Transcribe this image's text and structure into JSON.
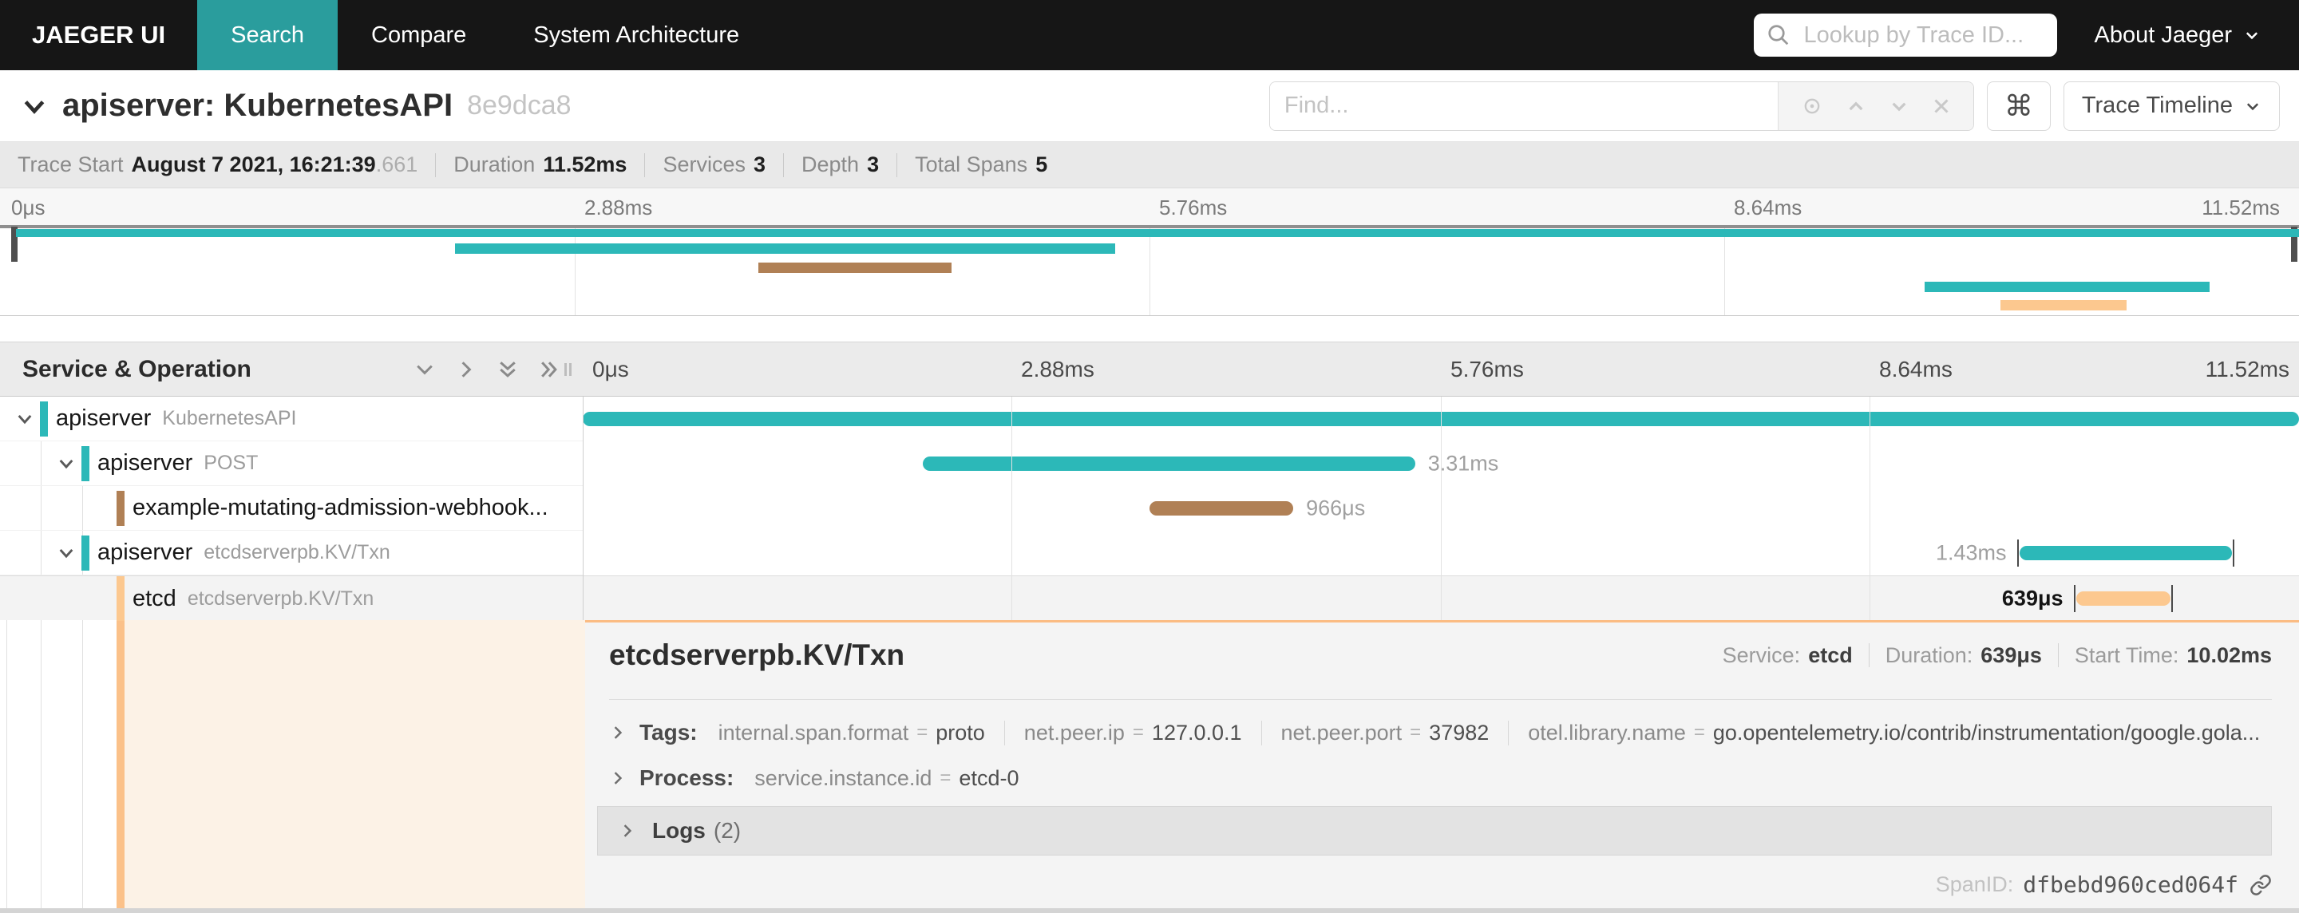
{
  "nav": {
    "brand": "JAEGER UI",
    "tabs": [
      {
        "label": "Search"
      },
      {
        "label": "Compare"
      },
      {
        "label": "System Architecture"
      }
    ],
    "lookup_placeholder": "Lookup by Trace ID...",
    "about_label": "About Jaeger",
    "active_tab_color": "#2a9d9d"
  },
  "trace_header": {
    "title": "apiserver: KubernetesAPI",
    "trace_id": "8e9dca8",
    "find_placeholder": "Find...",
    "shortcut_symbol": "⌘",
    "view_label": "Trace Timeline"
  },
  "summary": {
    "trace_start_label": "Trace Start",
    "trace_start_value": "August 7 2021, 16:21:39",
    "trace_start_fraction": ".661",
    "duration_label": "Duration",
    "duration_value": "11.52ms",
    "services_label": "Services",
    "services_value": "3",
    "depth_label": "Depth",
    "depth_value": "3",
    "spans_label": "Total Spans",
    "spans_value": "5"
  },
  "minimap": {
    "ticks": [
      "0μs",
      "2.88ms",
      "5.76ms",
      "8.64ms",
      "11.52ms"
    ],
    "spans": [
      {
        "left": "0.7%",
        "width": "99.3%",
        "color": "#2cb8b8"
      },
      {
        "left": "19.8%",
        "width": "28.7%",
        "color": "#2cb8b8"
      },
      {
        "left": "33.0%",
        "width": "8.4%",
        "color": "#b08055"
      },
      {
        "left": "83.7%",
        "width": "12.4%",
        "color": "#2cb8b8"
      },
      {
        "left": "87.0%",
        "width": "5.5%",
        "color": "#fcc88f"
      }
    ]
  },
  "timeline": {
    "panel_title": "Service & Operation",
    "ticks": [
      "0μs",
      "2.88ms",
      "5.76ms",
      "8.64ms",
      "11.52ms"
    ],
    "rows": [
      {
        "name": "apiserver",
        "op": "KubernetesAPI",
        "bar": {
          "left": "0%",
          "width": "100%",
          "color": "#2cb8b8"
        },
        "duration_label": ""
      },
      {
        "name": "apiserver",
        "op": "POST",
        "bar": {
          "left": "19.8%",
          "width": "28.7%",
          "color": "#2cb8b8"
        },
        "duration_label": "3.31ms"
      },
      {
        "name": "example-mutating-admission-webhook...",
        "op": "",
        "bar": {
          "left": "33.0%",
          "width": "8.4%",
          "color": "#b08055"
        },
        "duration_label": "966μs"
      },
      {
        "name": "apiserver",
        "op": "etcdserverpb.KV/Txn",
        "bar": {
          "left": "83.7%",
          "width": "12.4%",
          "color": "#2cb8b8"
        },
        "duration_label": "1.43ms"
      },
      {
        "name": "etcd",
        "op": "etcdserverpb.KV/Txn",
        "bar": {
          "left": "87.0%",
          "width": "5.5%",
          "color": "#fcc88f"
        },
        "duration_label": "639μs"
      }
    ]
  },
  "detail": {
    "title": "etcdserverpb.KV/Txn",
    "service_label": "Service:",
    "service_value": "etcd",
    "duration_label": "Duration:",
    "duration_value": "639μs",
    "start_label": "Start Time:",
    "start_value": "10.02ms",
    "eq": "=",
    "tags_label": "Tags:",
    "tags": [
      {
        "key": "internal.span.format",
        "value": "proto"
      },
      {
        "key": "net.peer.ip",
        "value": "127.0.0.1"
      },
      {
        "key": "net.peer.port",
        "value": "37982"
      },
      {
        "key": "otel.library.name",
        "value": "go.opentelemetry.io/contrib/instrumentation/google.gola..."
      }
    ],
    "process_label": "Process:",
    "process": [
      {
        "key": "service.instance.id",
        "value": "etcd-0"
      }
    ],
    "logs_label": "Logs",
    "logs_count": "(2)",
    "spanid_label": "SpanID:",
    "spanid_value": "dfbebd960ced064f"
  }
}
